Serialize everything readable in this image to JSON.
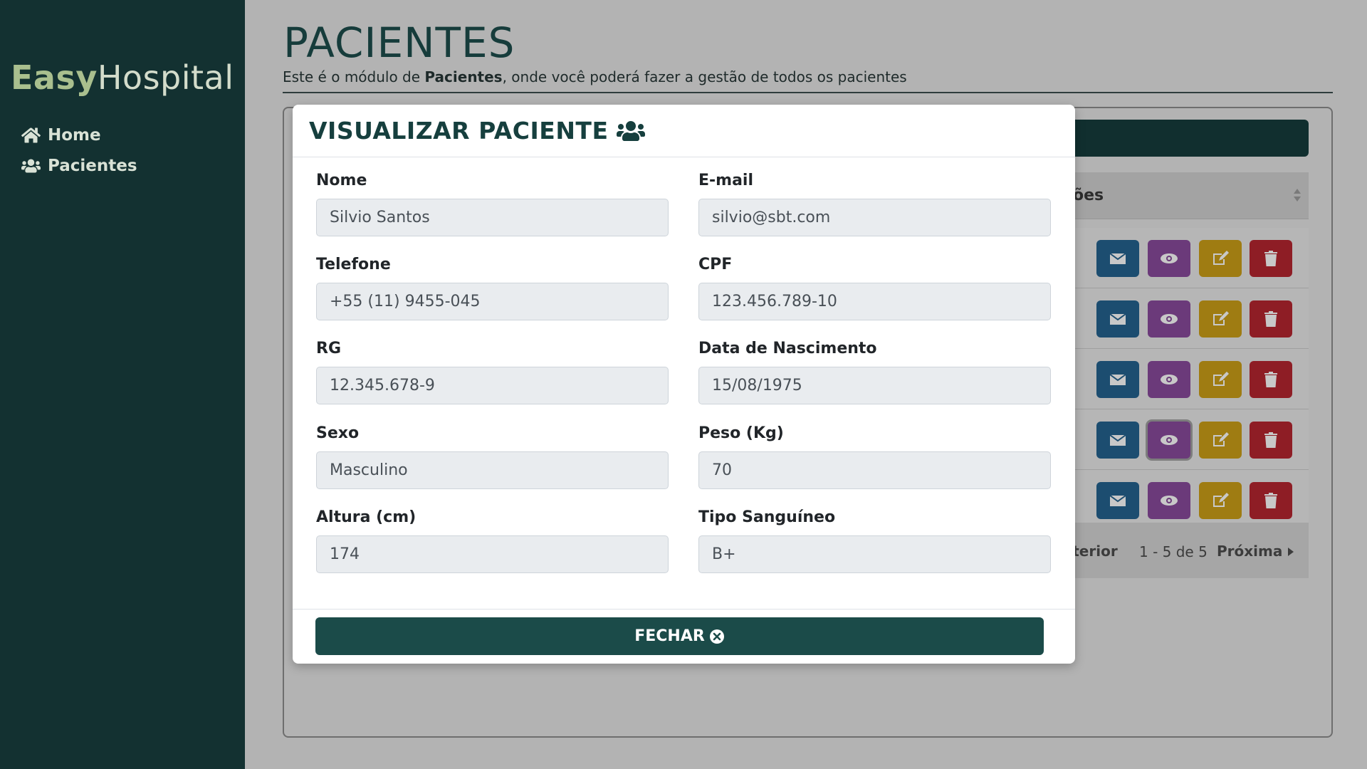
{
  "brand": {
    "bold": "Easy",
    "light": "Hospital"
  },
  "nav": [
    {
      "label": "Home",
      "icon": "home-icon"
    },
    {
      "label": "Pacientes",
      "icon": "users-icon"
    }
  ],
  "page": {
    "title": "PACIENTES",
    "subtitle_pre": "Este é o módulo de ",
    "subtitle_bold": "Pacientes",
    "subtitle_post": ", onde você poderá fazer a gestão de todos os pacientes"
  },
  "table": {
    "header_partial": "ões",
    "rows": 5,
    "actions": [
      "whatsapp-icon",
      "envelope-icon",
      "eye-icon",
      "edit-icon",
      "trash-icon"
    ],
    "pager": {
      "prev": "nterior",
      "count": "1 - 5 de 5",
      "next": "Próxima"
    }
  },
  "modal": {
    "title": "VISUALIZAR PACIENTE",
    "fields": {
      "nome": {
        "label": "Nome",
        "value": "Silvio Santos"
      },
      "email": {
        "label": "E-mail",
        "value": "silvio@sbt.com"
      },
      "telefone": {
        "label": "Telefone",
        "value": "+55 (11) 9455-045"
      },
      "cpf": {
        "label": "CPF",
        "value": "123.456.789-10"
      },
      "rg": {
        "label": "RG",
        "value": "12.345.678-9"
      },
      "nascimento": {
        "label": "Data de Nascimento",
        "value": "15/08/1975"
      },
      "sexo": {
        "label": "Sexo",
        "value": "Masculino"
      },
      "peso": {
        "label": "Peso (Kg)",
        "value": "70"
      },
      "altura": {
        "label": "Altura (cm)",
        "value": "174"
      },
      "sangue": {
        "label": "Tipo Sanguíneo",
        "value": "B+"
      }
    },
    "close_label": "FECHAR"
  },
  "colors": {
    "sidebar": "#133131",
    "primary": "#1b4b49",
    "green": "#1f8a3a",
    "blue": "#1c4d70",
    "purple": "#6b3a7a",
    "yellow": "#9f7c12",
    "red": "#8e1d25"
  }
}
